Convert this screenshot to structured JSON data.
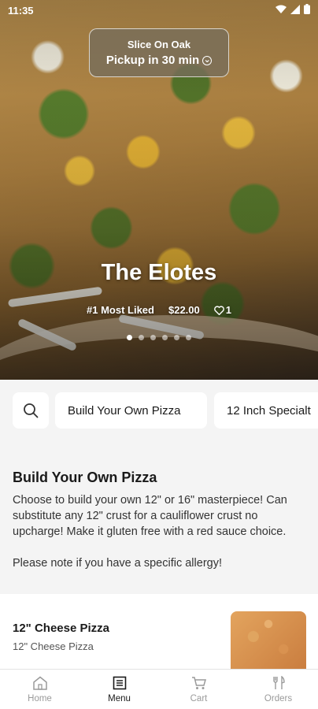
{
  "status_bar": {
    "time": "11:35"
  },
  "pickup": {
    "store_name": "Slice On Oak",
    "pickup_text": "Pickup in 30 min"
  },
  "hero": {
    "title": "The Elotes",
    "badge": "#1 Most Liked",
    "price": "$22.00",
    "likes": "1",
    "slide_count": 6,
    "active_slide": 0
  },
  "categories": {
    "items": [
      "Build Your Own Pizza",
      "12 Inch Specialt"
    ]
  },
  "section": {
    "title": "Build Your Own Pizza",
    "description": "Choose to build your own 12\" or 16\" masterpiece! Can substitute any 12\" crust for a cauliflower crust no upcharge! Make it gluten free with a red sauce choice.\n\nPlease note if you have a specific allergy!"
  },
  "menu_item": {
    "name": "12\" Cheese Pizza",
    "subtitle": "12\" Cheese Pizza"
  },
  "bottom_nav": {
    "items": [
      {
        "label": "Home",
        "icon": "home-icon"
      },
      {
        "label": "Menu",
        "icon": "menu-icon"
      },
      {
        "label": "Cart",
        "icon": "cart-icon"
      },
      {
        "label": "Orders",
        "icon": "utensils-icon"
      }
    ],
    "active_index": 1
  }
}
